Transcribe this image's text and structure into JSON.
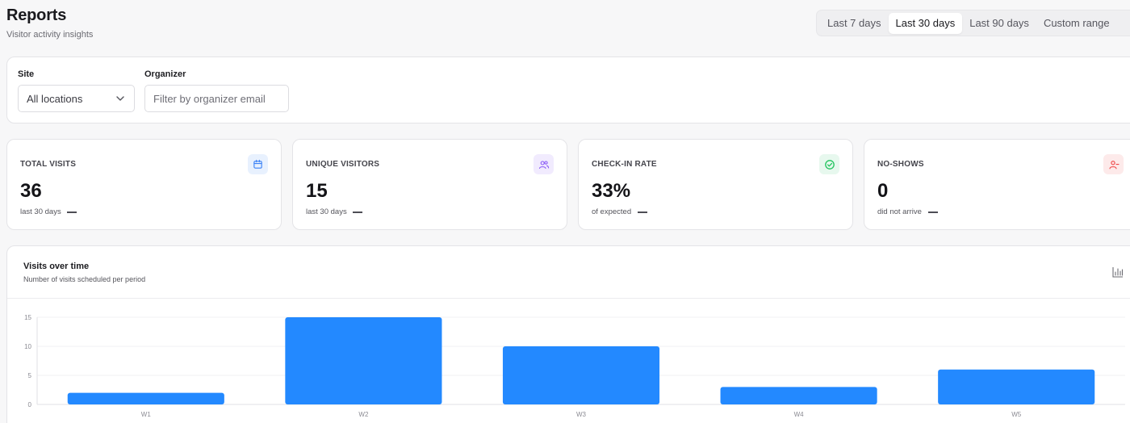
{
  "header": {
    "title": "Reports",
    "subtitle": "Visitor activity insights"
  },
  "range_tabs": [
    {
      "label": "Last 7 days",
      "active": false
    },
    {
      "label": "Last 30 days",
      "active": true
    },
    {
      "label": "Last 90 days",
      "active": false
    },
    {
      "label": "Custom range",
      "active": false
    }
  ],
  "filters": {
    "site_label": "Site",
    "site_value": "All locations",
    "organizer_label": "Organizer",
    "organizer_placeholder": "Filter by organizer email"
  },
  "stats": [
    {
      "title": "TOTAL VISITS",
      "value": "36",
      "sub": "last 30 days",
      "icon": "calendar-icon",
      "icon_color": "#3b82f6",
      "icon_bg": "#e8f1fe"
    },
    {
      "title": "UNIQUE VISITORS",
      "value": "15",
      "sub": "last 30 days",
      "icon": "users-icon",
      "icon_color": "#8b5cf6",
      "icon_bg": "#f1ebfe"
    },
    {
      "title": "CHECK-IN RATE",
      "value": "33%",
      "sub": "of expected",
      "icon": "check-circle-icon",
      "icon_color": "#22c55e",
      "icon_bg": "#e7f8ee"
    },
    {
      "title": "NO-SHOWS",
      "value": "0",
      "sub": "did not arrive",
      "icon": "user-minus-icon",
      "icon_color": "#ef4444",
      "icon_bg": "#fdeaea"
    }
  ],
  "chart": {
    "title": "Visits over time",
    "subtitle": "Number of visits scheduled per period",
    "toggle_icon": "bar-chart-icon"
  },
  "chart_data": {
    "type": "bar",
    "categories": [
      "W1",
      "W2",
      "W3",
      "W4",
      "W5"
    ],
    "values": [
      2,
      15,
      10,
      3,
      6
    ],
    "ylim": [
      0,
      15
    ],
    "yticks": [
      0,
      5,
      10,
      15
    ],
    "grid": true,
    "color": "#2389ff"
  }
}
